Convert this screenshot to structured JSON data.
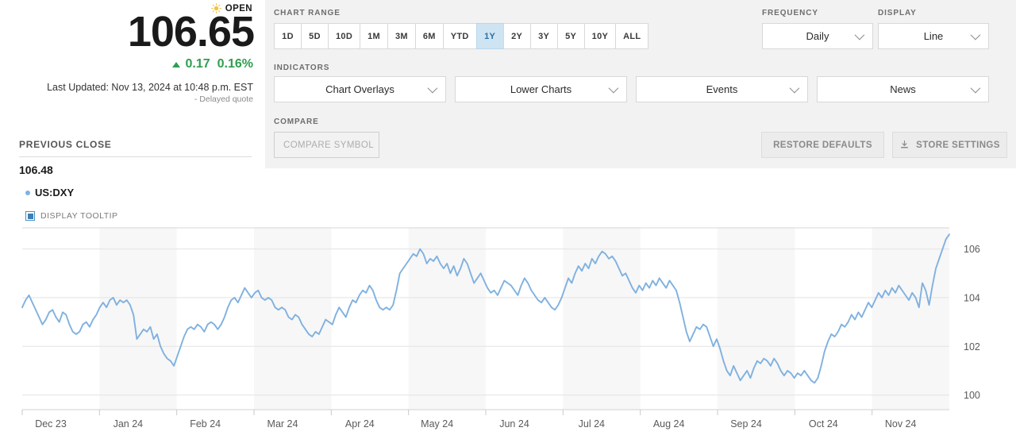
{
  "quote": {
    "market_status": "OPEN",
    "status_icon": "sun-icon",
    "price": "106.65",
    "change": "0.17",
    "change_percent": "0.16%",
    "change_direction": "up",
    "change_color": "#2e9e4f",
    "last_updated": "Last Updated: Nov 13, 2024 at 10:48 p.m. EST",
    "delayed_note": "- Delayed quote",
    "previous_close_label": "PREVIOUS CLOSE",
    "previous_close_value": "106.48",
    "series_name": "US:DXY",
    "series_color": "#7fb1e0",
    "display_tooltip_label": "DISPLAY TOOLTIP",
    "display_tooltip_checked": true
  },
  "toolbar": {
    "chart_range_label": "CHART RANGE",
    "ranges": [
      {
        "label": "1D",
        "active": false
      },
      {
        "label": "5D",
        "active": false
      },
      {
        "label": "10D",
        "active": false
      },
      {
        "label": "1M",
        "active": false
      },
      {
        "label": "3M",
        "active": false
      },
      {
        "label": "6M",
        "active": false
      },
      {
        "label": "YTD",
        "active": false
      },
      {
        "label": "1Y",
        "active": true
      },
      {
        "label": "2Y",
        "active": false
      },
      {
        "label": "3Y",
        "active": false
      },
      {
        "label": "5Y",
        "active": false
      },
      {
        "label": "10Y",
        "active": false
      },
      {
        "label": "ALL",
        "active": false
      }
    ],
    "frequency_label": "FREQUENCY",
    "frequency_value": "Daily",
    "display_label": "DISPLAY",
    "display_value": "Line",
    "indicators_label": "INDICATORS",
    "indicators": [
      {
        "label": "Chart Overlays"
      },
      {
        "label": "Lower Charts"
      },
      {
        "label": "Events"
      },
      {
        "label": "News"
      }
    ],
    "compare_label": "COMPARE",
    "compare_placeholder": "COMPARE SYMBOL",
    "compare_value": "",
    "restore_defaults_label": "RESTORE DEFAULTS",
    "store_settings_label": "STORE SETTINGS",
    "store_settings_icon": "download-icon",
    "active_range_bg": "#cfe4f2"
  },
  "chart_data": {
    "type": "line",
    "title": "US:DXY 1 Year Daily Line Chart",
    "xlabel": "",
    "ylabel": "",
    "grid": true,
    "legend_position": "left-panel",
    "series": [
      {
        "name": "US:DXY",
        "color": "#7fb1e0",
        "values": [
          103.6,
          103.9,
          104.1,
          103.8,
          103.5,
          103.2,
          102.9,
          103.1,
          103.4,
          103.5,
          103.2,
          103.0,
          103.4,
          103.3,
          102.9,
          102.6,
          102.5,
          102.6,
          102.9,
          103.0,
          102.8,
          103.1,
          103.3,
          103.6,
          103.8,
          103.6,
          103.9,
          104.0,
          103.7,
          103.9,
          103.8,
          103.9,
          103.7,
          103.3,
          102.3,
          102.5,
          102.7,
          102.6,
          102.8,
          102.3,
          102.5,
          102.0,
          101.7,
          101.5,
          101.4,
          101.2,
          101.6,
          102.0,
          102.4,
          102.7,
          102.8,
          102.7,
          102.9,
          102.8,
          102.6,
          102.9,
          103.0,
          102.9,
          102.7,
          102.9,
          103.2,
          103.6,
          103.9,
          104.0,
          103.8,
          104.1,
          104.4,
          104.2,
          104.0,
          104.2,
          104.3,
          104.0,
          103.9,
          104.0,
          103.9,
          103.6,
          103.5,
          103.6,
          103.5,
          103.2,
          103.1,
          103.3,
          103.2,
          102.9,
          102.7,
          102.5,
          102.4,
          102.6,
          102.5,
          102.8,
          103.1,
          103.0,
          102.9,
          103.3,
          103.6,
          103.4,
          103.2,
          103.6,
          103.9,
          103.8,
          104.1,
          104.3,
          104.2,
          104.5,
          104.3,
          103.9,
          103.6,
          103.5,
          103.6,
          103.5,
          103.7,
          104.3,
          105.0,
          105.2,
          105.4,
          105.6,
          105.8,
          105.7,
          106.0,
          105.8,
          105.4,
          105.6,
          105.5,
          105.7,
          105.4,
          105.2,
          105.4,
          105.0,
          105.3,
          104.9,
          105.2,
          105.6,
          105.4,
          105.0,
          104.6,
          104.8,
          105.0,
          104.7,
          104.4,
          104.2,
          104.3,
          104.1,
          104.4,
          104.7,
          104.6,
          104.5,
          104.3,
          104.1,
          104.5,
          104.8,
          104.6,
          104.3,
          104.1,
          103.9,
          103.8,
          104.0,
          103.8,
          103.6,
          103.5,
          103.7,
          104.0,
          104.4,
          104.8,
          104.6,
          105.0,
          105.3,
          105.1,
          105.4,
          105.2,
          105.6,
          105.4,
          105.7,
          105.9,
          105.8,
          105.6,
          105.7,
          105.5,
          105.2,
          104.9,
          105.0,
          104.7,
          104.4,
          104.2,
          104.5,
          104.3,
          104.6,
          104.4,
          104.7,
          104.5,
          104.8,
          104.6,
          104.4,
          104.7,
          104.5,
          104.3,
          103.8,
          103.2,
          102.6,
          102.2,
          102.5,
          102.8,
          102.7,
          102.9,
          102.8,
          102.4,
          102.0,
          102.3,
          101.9,
          101.4,
          101.0,
          100.8,
          101.2,
          100.9,
          100.6,
          100.8,
          101.0,
          100.7,
          101.1,
          101.4,
          101.3,
          101.5,
          101.4,
          101.2,
          101.5,
          101.3,
          101.0,
          100.8,
          101.0,
          100.9,
          100.7,
          100.9,
          100.8,
          101.0,
          100.8,
          100.6,
          100.5,
          100.7,
          101.2,
          101.8,
          102.2,
          102.5,
          102.4,
          102.6,
          102.9,
          102.8,
          103.0,
          103.3,
          103.1,
          103.4,
          103.2,
          103.5,
          103.8,
          103.6,
          103.9,
          104.2,
          104.0,
          104.3,
          104.1,
          104.4,
          104.2,
          104.5,
          104.3,
          104.1,
          103.9,
          104.2,
          104.0,
          103.6,
          104.6,
          104.3,
          103.7,
          104.5,
          105.2,
          105.6,
          106.0,
          106.4,
          106.6
        ]
      }
    ],
    "ytick_labels": [
      "100",
      "102",
      "104",
      "106"
    ],
    "ytick_values": [
      100,
      102,
      104,
      106
    ],
    "ylim": [
      99.4,
      106.9
    ],
    "xtick_labels": [
      "Dec 23",
      "Jan 24",
      "Feb 24",
      "Mar 24",
      "Apr 24",
      "May 24",
      "Jun 24",
      "Jul 24",
      "Aug 24",
      "Sep 24",
      "Oct 24",
      "Nov 24"
    ],
    "band_color": "#f7f7f7",
    "gridline_color": "#e3e3e3",
    "axis_label_color": "#5a5a5a"
  }
}
